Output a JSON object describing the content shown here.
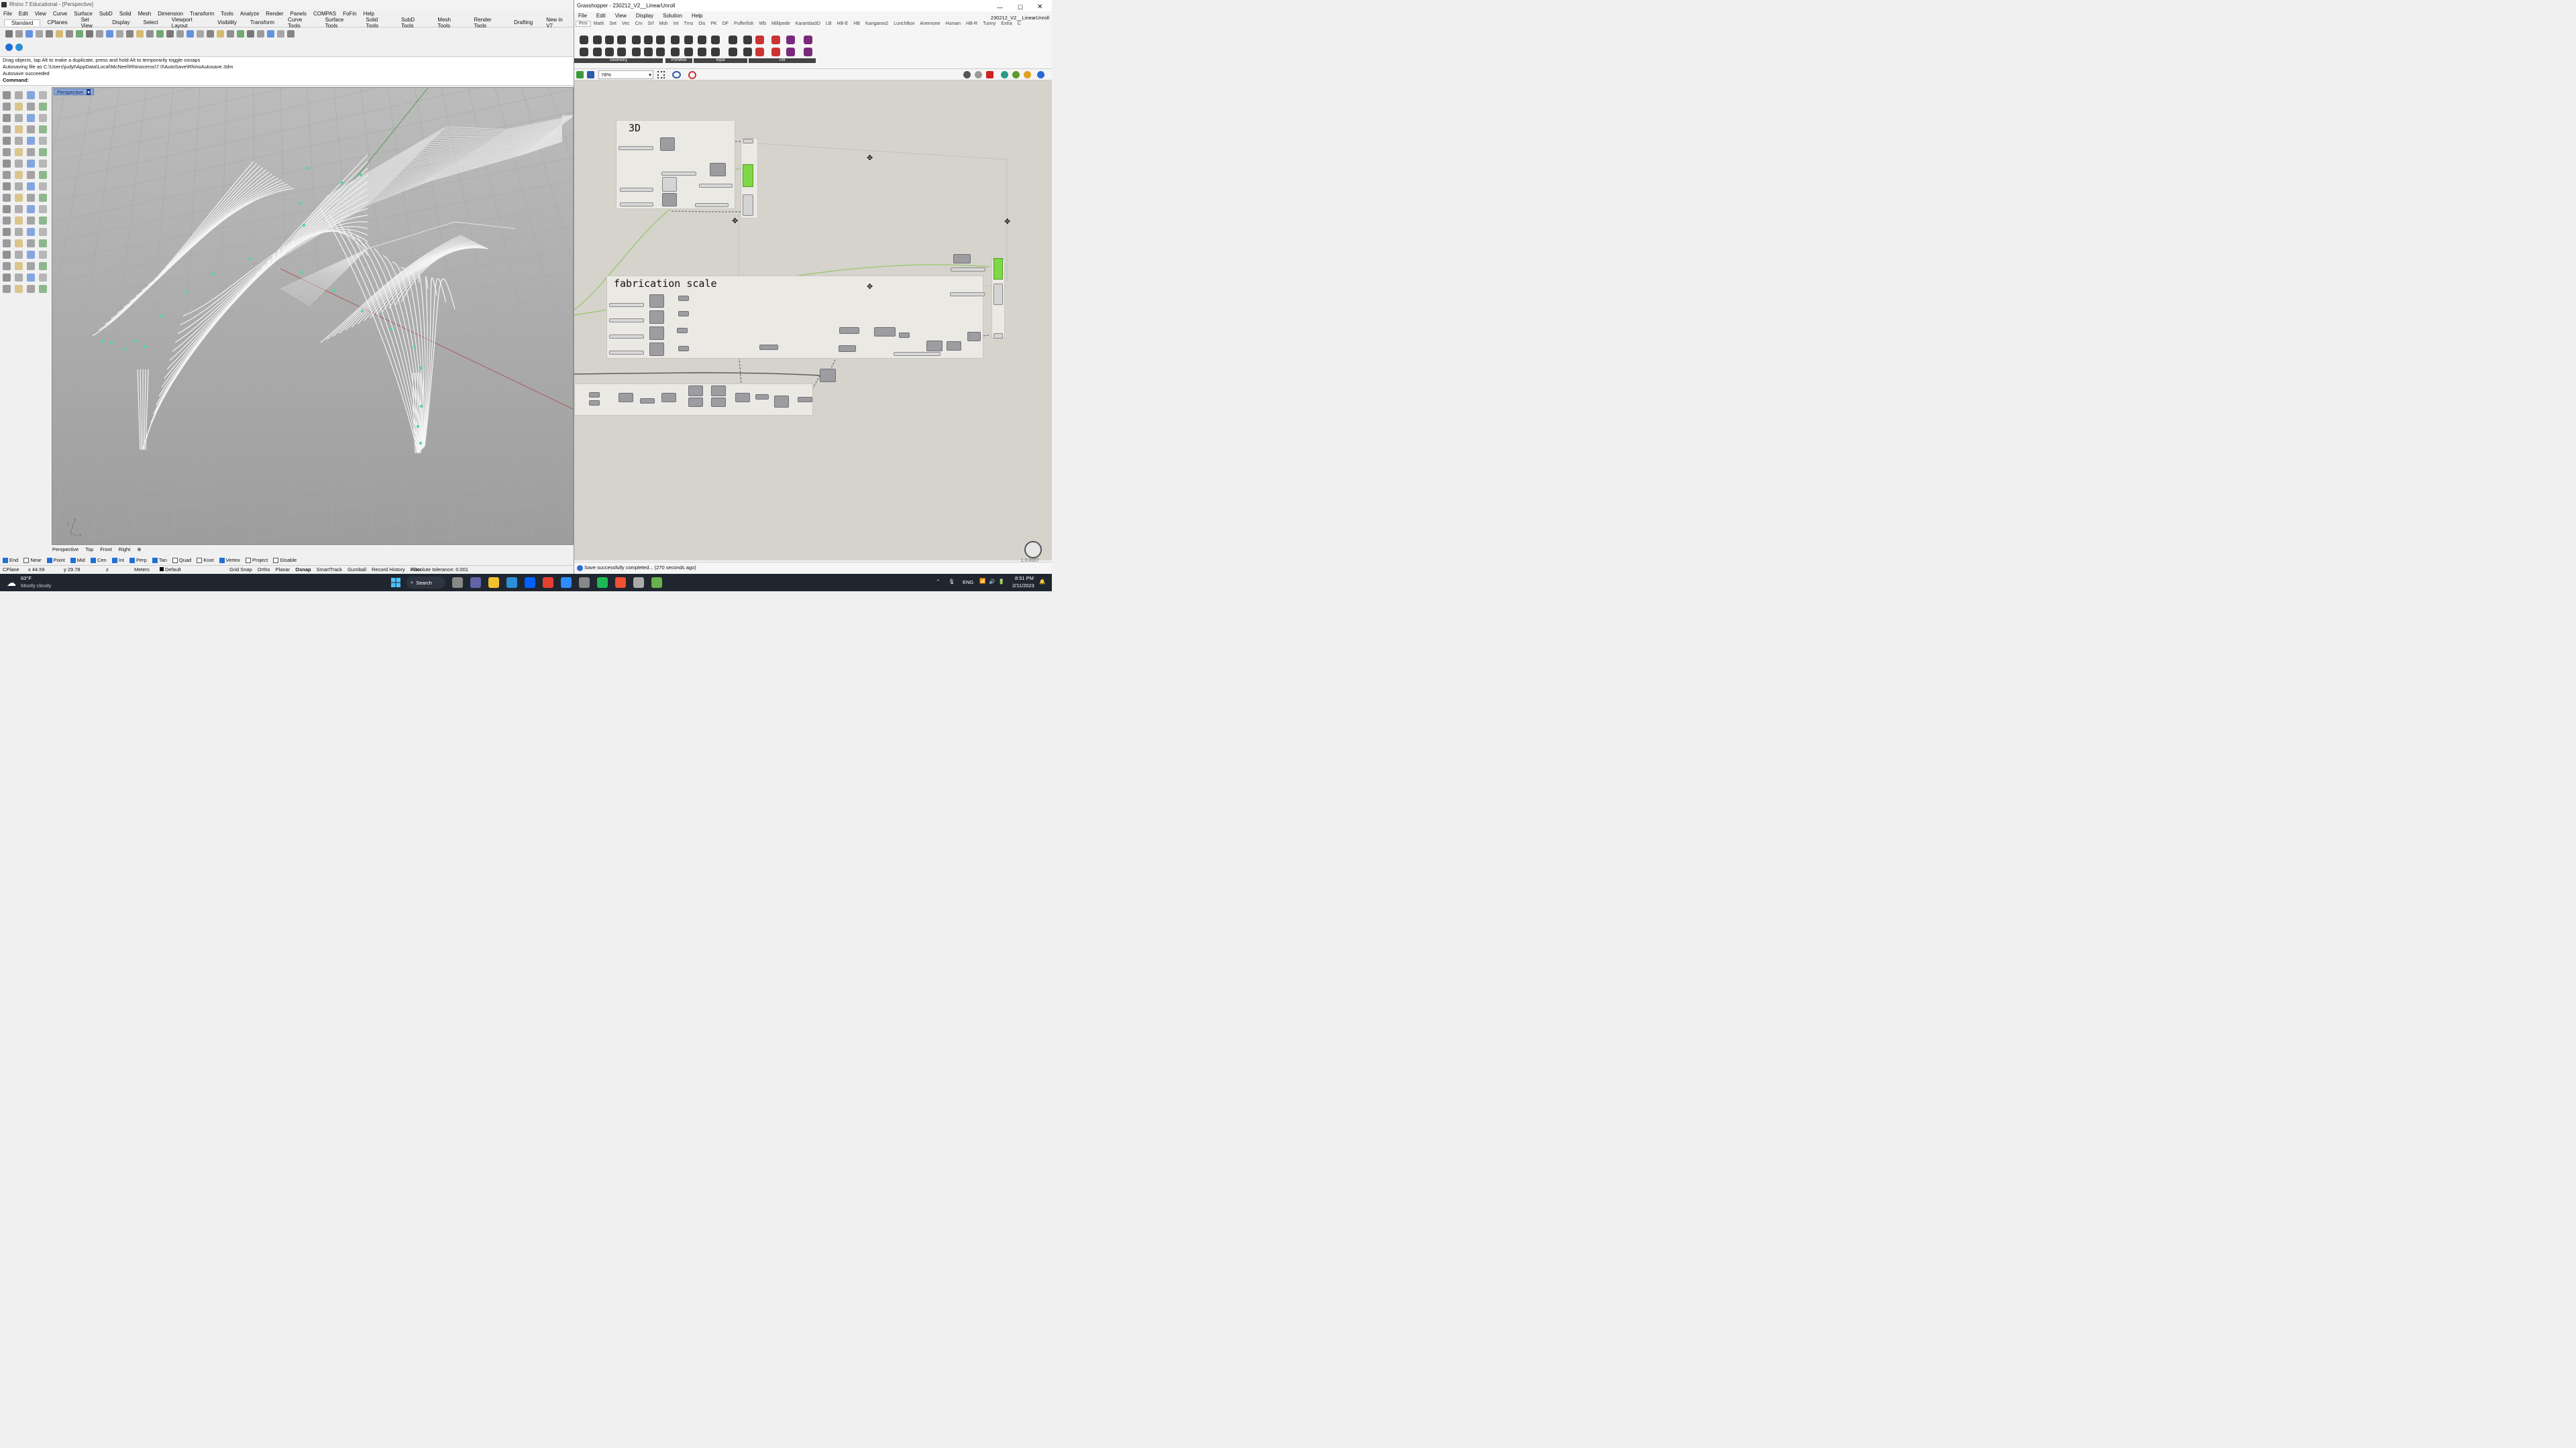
{
  "rhino": {
    "title": "Rhino 7 Educational - [Perspective]",
    "menu": [
      "File",
      "Edit",
      "View",
      "Curve",
      "Surface",
      "SubD",
      "Solid",
      "Mesh",
      "Dimension",
      "Transform",
      "Tools",
      "Analyze",
      "Render",
      "Panels",
      "COMPAS",
      "FoFin",
      "Help"
    ],
    "tabs": [
      "Standard",
      "CPlanes",
      "Set View",
      "Display",
      "Select",
      "Viewport Layout",
      "Visibility",
      "Transform",
      "Curve Tools",
      "Surface Tools",
      "Solid Tools",
      "SubD Tools",
      "Mesh Tools",
      "Render Tools",
      "Drafting",
      "New in V7"
    ],
    "active_tab": "Standard",
    "command_history": [
      "Drag objects, tap Alt to make a duplicate, press and hold Alt to temporarily toggle osnaps",
      "Autosaving file as C:\\Users\\judyt\\AppData\\Local\\McNeel\\Rhinoceros\\7.0\\AutoSave\\RhinoAutosave.3dm",
      "Autosave succeeded"
    ],
    "command_prompt": "Command:",
    "viewport_label": "Perspective",
    "viewport_tabs": [
      "Perspective",
      "Top",
      "Front",
      "Right"
    ],
    "osnaps": [
      {
        "label": "End",
        "checked": true
      },
      {
        "label": "Near",
        "checked": false
      },
      {
        "label": "Point",
        "checked": true
      },
      {
        "label": "Mid",
        "checked": true
      },
      {
        "label": "Cen",
        "checked": true
      },
      {
        "label": "Int",
        "checked": true
      },
      {
        "label": "Perp",
        "checked": true
      },
      {
        "label": "Tan",
        "checked": true
      },
      {
        "label": "Quad",
        "checked": false
      },
      {
        "label": "Knot",
        "checked": false
      },
      {
        "label": "Vertex",
        "checked": true
      },
      {
        "label": "Project",
        "checked": false
      },
      {
        "label": "Disable",
        "checked": false
      }
    ],
    "status": {
      "cplane": "CPlane",
      "x": "x 44.59",
      "y": "y 29.78",
      "z": "z",
      "units": "Meters",
      "layer": "Default",
      "toggles": [
        "Grid Snap",
        "Ortho",
        "Planar",
        "Osnap",
        "SmartTrack",
        "Gumball",
        "Record History",
        "Filter"
      ],
      "active_toggle": "Osnap",
      "tolerance": "Absolute tolerance: 0.001"
    }
  },
  "grasshopper": {
    "title": "Grasshopper - 230212_V2__LinearUnroll",
    "doc_name": "230212_V2__LinearUnroll",
    "menu": [
      "File",
      "Edit",
      "View",
      "Display",
      "Solution",
      "Help"
    ],
    "tabs": [
      "Prm",
      "Math",
      "Set",
      "Vec",
      "Crv",
      "Srf",
      "Msh",
      "Int",
      "Trns",
      "Dis",
      "PK",
      "DF",
      "Pufferfish",
      "Wb",
      "Millipede",
      "Karamba3D",
      "LB",
      "HB-E",
      "HB",
      "Kangaroo2",
      "LunchBox",
      "Anemone",
      "Human",
      "HB-R",
      "Tunny",
      "Extra",
      "C"
    ],
    "active_tab": "Prm",
    "ribbon_groups": [
      "Geometry",
      "Primitive",
      "Input",
      "Util"
    ],
    "zoom": "78%",
    "groups": {
      "g3d": "3D",
      "fab": "fabrication scale"
    },
    "status_message": "Save successfully completed... (270 seconds ago)",
    "version": "1.0.0007"
  },
  "taskbar": {
    "weather_temp": "63°F",
    "weather_desc": "Mostly cloudy",
    "search": "Search",
    "lang": "ENG",
    "time": "8:51 PM",
    "date": "2/11/2023"
  },
  "colors": {
    "accent": "#7fd847",
    "viewport_label": "#8aa8d8",
    "taskbar": "#1f2630"
  }
}
